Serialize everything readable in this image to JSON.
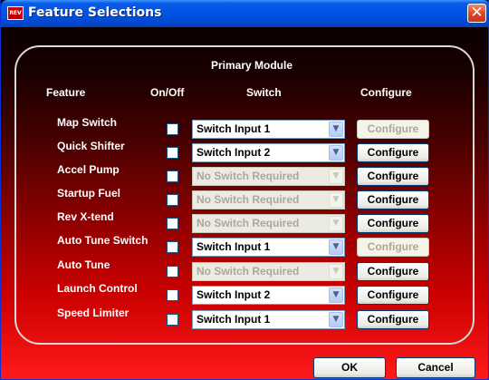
{
  "window": {
    "title": "Feature Selections",
    "icon_text": "REV",
    "close_glyph": "✕"
  },
  "group": {
    "title": "Primary Module"
  },
  "headers": {
    "feature": "Feature",
    "onoff": "On/Off",
    "switch": "Switch",
    "configure": "Configure"
  },
  "rows": [
    {
      "feature": "Map Switch",
      "checked": false,
      "switch": "Switch Input 1",
      "switch_enabled": true,
      "configure": "Configure",
      "configure_enabled": false
    },
    {
      "feature": "Quick Shifter",
      "checked": false,
      "switch": "Switch Input 2",
      "switch_enabled": true,
      "configure": "Configure",
      "configure_enabled": true
    },
    {
      "feature": "Accel Pump",
      "checked": false,
      "switch": "No Switch Required",
      "switch_enabled": false,
      "configure": "Configure",
      "configure_enabled": true
    },
    {
      "feature": "Startup Fuel",
      "checked": false,
      "switch": "No Switch Required",
      "switch_enabled": false,
      "configure": "Configure",
      "configure_enabled": true
    },
    {
      "feature": "Rev X-tend",
      "checked": false,
      "switch": "No Switch Required",
      "switch_enabled": false,
      "configure": "Configure",
      "configure_enabled": true
    },
    {
      "feature": "Auto Tune Switch",
      "checked": false,
      "switch": "Switch Input 1",
      "switch_enabled": true,
      "configure": "Configure",
      "configure_enabled": false
    },
    {
      "feature": "Auto Tune",
      "checked": false,
      "switch": "No Switch Required",
      "switch_enabled": false,
      "configure": "Configure",
      "configure_enabled": true
    },
    {
      "feature": "Launch Control",
      "checked": false,
      "switch": "Switch Input 2",
      "switch_enabled": true,
      "configure": "Configure",
      "configure_enabled": true
    },
    {
      "feature": "Speed Limiter",
      "checked": false,
      "switch": "Switch Input 1",
      "switch_enabled": true,
      "configure": "Configure",
      "configure_enabled": true
    }
  ],
  "buttons": {
    "ok": "OK",
    "cancel": "Cancel"
  },
  "dropdown_glyph": "▼"
}
